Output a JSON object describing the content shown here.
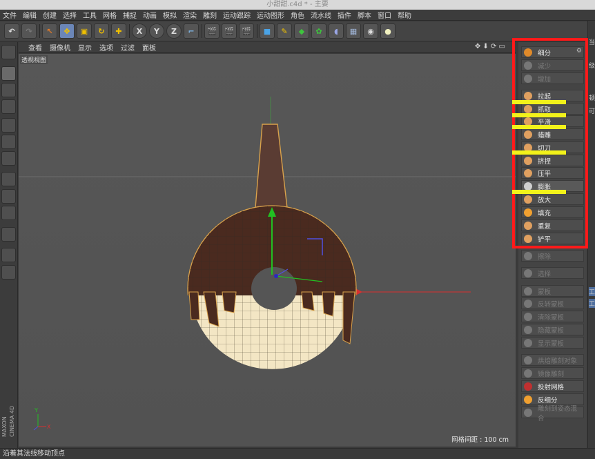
{
  "window": {
    "title": "小甜甜.c4d * - 主要"
  },
  "menubar": {
    "items": [
      "文件",
      "编辑",
      "创建",
      "选择",
      "工具",
      "网格",
      "捕捉",
      "动画",
      "模拟",
      "渲染",
      "雕刻",
      "运动跟踪",
      "运动图形",
      "角色",
      "流水线",
      "插件",
      "脚本",
      "窗口",
      "帮助"
    ]
  },
  "toolbar": {
    "axis_labels": [
      "X",
      "Y",
      "Z"
    ]
  },
  "viewport_menu": {
    "items": [
      "查看",
      "摄像机",
      "显示",
      "选项",
      "过滤",
      "面板"
    ]
  },
  "viewport": {
    "label": "透视视图",
    "grid_spacing": "网格间距 : 100 cm",
    "axis_y": "Y",
    "axis_x": "X"
  },
  "sculpt_panel": {
    "items": [
      {
        "label": "细分",
        "enabled": true
      },
      {
        "label": "减少",
        "enabled": false
      },
      {
        "label": "增加",
        "enabled": false
      },
      {
        "label": "拉起",
        "enabled": true
      },
      {
        "label": "抓取",
        "enabled": true
      },
      {
        "label": "平滑",
        "enabled": true
      },
      {
        "label": "蜡雕",
        "enabled": true
      },
      {
        "label": "切刀",
        "enabled": true
      },
      {
        "label": "挤捏",
        "enabled": true
      },
      {
        "label": "压平",
        "enabled": true
      },
      {
        "label": "膨胀",
        "enabled": true
      },
      {
        "label": "放大",
        "enabled": true
      },
      {
        "label": "填充",
        "enabled": true
      },
      {
        "label": "重复",
        "enabled": true
      },
      {
        "label": "铲平",
        "enabled": true
      },
      {
        "label": "擦除",
        "enabled": false
      },
      {
        "label": "选择",
        "enabled": false
      },
      {
        "label": "蒙板",
        "enabled": false
      },
      {
        "label": "反转蒙板",
        "enabled": false
      },
      {
        "label": "清除蒙板",
        "enabled": false
      },
      {
        "label": "隐藏蒙板",
        "enabled": false
      },
      {
        "label": "显示蒙板",
        "enabled": false
      },
      {
        "label": "烘焙雕刻对象",
        "enabled": false
      },
      {
        "label": "镜像雕刻",
        "enabled": false
      },
      {
        "label": "投射网格",
        "enabled": true
      },
      {
        "label": "反细分",
        "enabled": true
      },
      {
        "label": "雕刻到姿态混合",
        "enabled": false
      }
    ]
  },
  "far_right": {
    "chars": [
      "当",
      "级",
      "顿",
      "可",
      "工",
      "工"
    ]
  },
  "left_brand": "MAXON CINEMA 4D",
  "statusbar": {
    "text": "沿着其法线移动顶点"
  },
  "colors": {
    "highlight_box": "#ff1a1a",
    "annotation_bar": "#f2f21a",
    "chocolate": "#4a2a1f",
    "dough": "#f3e6c4"
  }
}
